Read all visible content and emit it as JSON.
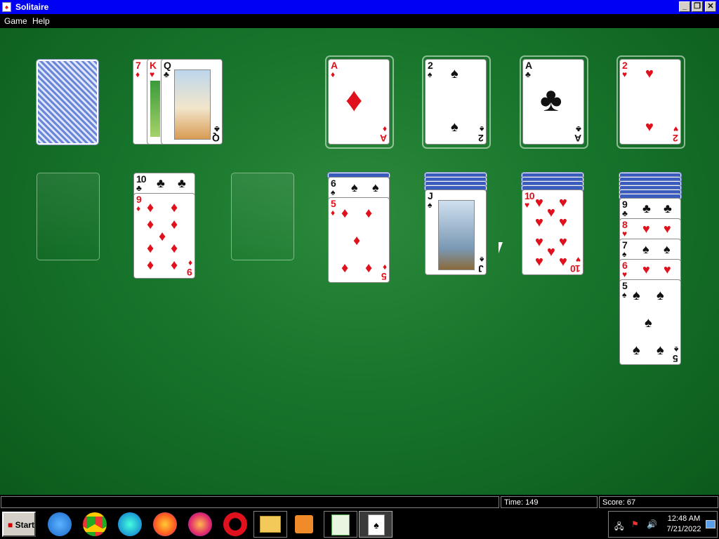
{
  "window": {
    "title": "Solitaire",
    "controls": [
      "_",
      "❐",
      "✕"
    ]
  },
  "menu": [
    "Game",
    "Help"
  ],
  "stock": {
    "kind": "face-down"
  },
  "waste": [
    {
      "rank": "7",
      "suit": "♦",
      "color": "red"
    },
    {
      "rank": "K",
      "suit": "♥",
      "color": "red"
    },
    {
      "rank": "Q",
      "suit": "♣",
      "color": "blk"
    }
  ],
  "foundations": [
    {
      "rank": "A",
      "suit": "♦",
      "color": "red"
    },
    {
      "rank": "2",
      "suit": "♠",
      "color": "blk"
    },
    {
      "rank": "A",
      "suit": "♣",
      "color": "blk"
    },
    {
      "rank": "2",
      "suit": "♥",
      "color": "red"
    }
  ],
  "tableau": [
    {
      "hidden": 0,
      "cards": []
    },
    {
      "hidden": 0,
      "cards": [
        {
          "rank": "10",
          "suit": "♣",
          "color": "blk"
        },
        {
          "rank": "9",
          "suit": "♦",
          "color": "red"
        }
      ]
    },
    {
      "hidden": 0,
      "cards": []
    },
    {
      "hidden": 1,
      "cards": [
        {
          "rank": "6",
          "suit": "♠",
          "color": "blk"
        },
        {
          "rank": "5",
          "suit": "♦",
          "color": "red"
        }
      ]
    },
    {
      "hidden": 4,
      "cards": [
        {
          "rank": "J",
          "suit": "♠",
          "color": "blk"
        }
      ]
    },
    {
      "hidden": 4,
      "cards": [
        {
          "rank": "10",
          "suit": "♥",
          "color": "red"
        }
      ]
    },
    {
      "hidden": 6,
      "cards": [
        {
          "rank": "9",
          "suit": "♣",
          "color": "blk"
        },
        {
          "rank": "8",
          "suit": "♥",
          "color": "red"
        },
        {
          "rank": "7",
          "suit": "♠",
          "color": "blk"
        },
        {
          "rank": "6",
          "suit": "♥",
          "color": "red"
        },
        {
          "rank": "5",
          "suit": "♠",
          "color": "blk"
        }
      ]
    }
  ],
  "status": {
    "message": "",
    "time": "Time:  149",
    "score": "Score: 67"
  },
  "taskbar": {
    "start": "Start",
    "apps": [
      "ie-icon",
      "chrome-icon",
      "edge-icon",
      "firefox-icon",
      "firefox-dev-icon",
      "opera-icon",
      "explorer-icon",
      "media-icon",
      "notepad-icon",
      "solitaire-icon"
    ]
  },
  "clock": {
    "time": "12:48 AM",
    "date": "7/21/2022"
  }
}
